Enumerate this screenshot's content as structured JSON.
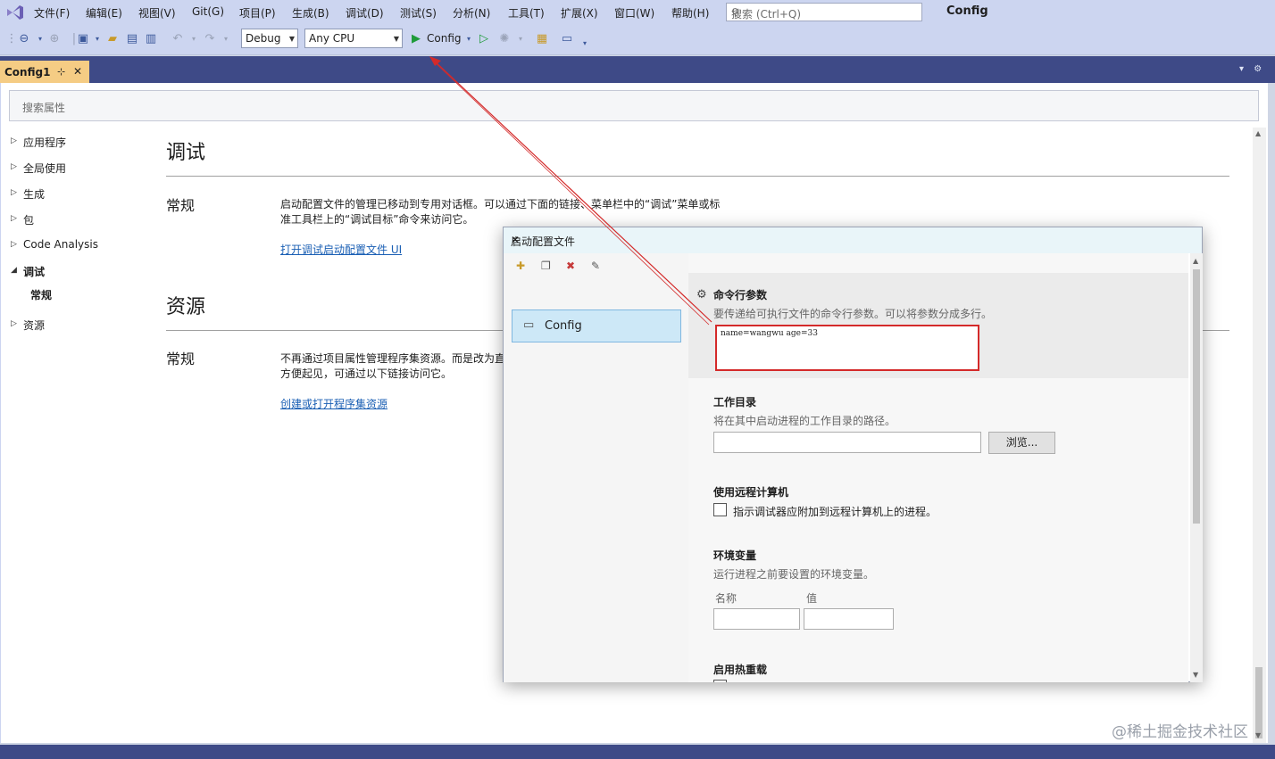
{
  "menubar": {
    "items": [
      "文件(F)",
      "编辑(E)",
      "视图(V)",
      "Git(G)",
      "项目(P)",
      "生成(B)",
      "调试(D)",
      "测试(S)",
      "分析(N)",
      "工具(T)",
      "扩展(X)",
      "窗口(W)",
      "帮助(H)"
    ],
    "search_placeholder": "搜索 (Ctrl+Q)",
    "solution_name": "Config"
  },
  "toolbar": {
    "configuration": "Debug",
    "platform": "Any CPU",
    "start_label": "Config"
  },
  "tab": {
    "label": "Config1",
    "pin": "⊹",
    "close": "✕"
  },
  "properties": {
    "search_placeholder": "搜索属性",
    "nav": [
      "应用程序",
      "全局使用",
      "生成",
      "包",
      "Code Analysis",
      "调试",
      "常规",
      "资源"
    ],
    "debug_heading": "调试",
    "debug_general": "常规",
    "debug_text_1": "启动配置文件的管理已移动到专用对话框。可以通过下面的链接、菜单栏中的“调试”菜单或标",
    "debug_text_2": "准工具栏上的“调试目标”命令来访问它。",
    "debug_link": "打开调试启动配置文件 UI",
    "resources_heading": "资源",
    "resources_general": "常规",
    "resources_text_1": "不再通过项目属性管理程序集资源。而是改为直",
    "resources_text_2": "方便起见，可通过以下链接访问它。",
    "resources_link": "创建或打开程序集资源"
  },
  "dialog": {
    "title": "启动配置文件",
    "close": "✕",
    "profile": "Config",
    "cmd_title": "命令行参数",
    "cmd_desc": "要传递给可执行文件的命令行参数。可以将参数分成多行。",
    "cmd_value": "name=wangwu age=33",
    "workdir_title": "工作目录",
    "workdir_desc": "将在其中启动进程的工作目录的路径。",
    "browse": "浏览...",
    "remote_title": "使用远程计算机",
    "remote_desc": "指示调试器应附加到远程计算机上的进程。",
    "env_title": "环境变量",
    "env_desc": "运行进程之前要设置的环境变量。",
    "env_name": "名称",
    "env_value": "值",
    "hotreload_title": "启用热重载"
  },
  "watermark": "@稀土掘金技术社区",
  "colors": {
    "menubar_bg": "#ccd5f0",
    "tabstrip_bg": "#3e4a87",
    "active_tab": "#f5cc84",
    "link": "#1a5fb4",
    "highlight_border": "#d42a2a",
    "selected_profile": "#cde8f7"
  }
}
